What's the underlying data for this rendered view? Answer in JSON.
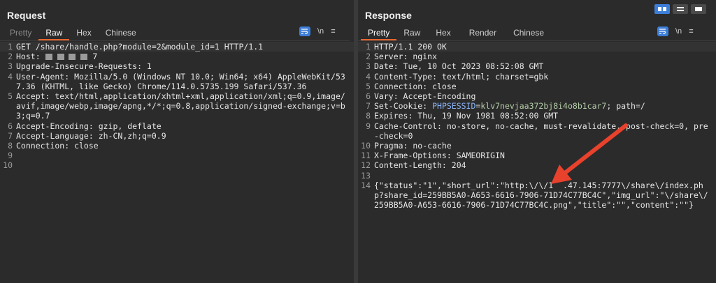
{
  "request": {
    "title": "Request",
    "tabs": [
      "Pretty",
      "Raw",
      "Hex",
      "Chinese"
    ],
    "active_tab": "Raw",
    "newline_label": "\\n",
    "lines": [
      {
        "n": "1",
        "text": "GET /share/handle.php?module=2&module_id=1 HTTP/1.1"
      },
      {
        "n": "2",
        "host_label": "Host:",
        "host_suffix": "7"
      },
      {
        "n": "3",
        "text": "Upgrade-Insecure-Requests: 1"
      },
      {
        "n": "4",
        "text": "User-Agent: Mozilla/5.0 (Windows NT 10.0; Win64; x64) AppleWebKit/537.36 (KHTML, like Gecko) Chrome/114.0.5735.199 Safari/537.36"
      },
      {
        "n": "5",
        "text": "Accept: text/html,application/xhtml+xml,application/xml;q=0.9,image/avif,image/webp,image/apng,*/*;q=0.8,application/signed-exchange;v=b3;q=0.7"
      },
      {
        "n": "6",
        "text": "Accept-Encoding: gzip, deflate"
      },
      {
        "n": "7",
        "text": "Accept-Language: zh-CN,zh;q=0.9"
      },
      {
        "n": "8",
        "text": "Connection: close"
      },
      {
        "n": "9",
        "text": ""
      },
      {
        "n": "10",
        "text": ""
      }
    ]
  },
  "response": {
    "title": "Response",
    "tabs": [
      "Pretty",
      "Raw",
      "Hex",
      "Render",
      "Chinese"
    ],
    "active_tab": "Pretty",
    "newline_label": "\\n",
    "lines": [
      {
        "n": "1",
        "text": "HTTP/1.1 200 OK"
      },
      {
        "n": "2",
        "text": "Server: nginx"
      },
      {
        "n": "3",
        "text": "Date: Tue, 10 Oct 2023 08:52:08 GMT"
      },
      {
        "n": "4",
        "text": "Content-Type: text/html; charset=gbk"
      },
      {
        "n": "5",
        "text": "Connection: close"
      },
      {
        "n": "6",
        "text": "Vary: Accept-Encoding"
      },
      {
        "n": "7",
        "cookie_label": "Set-Cookie: ",
        "cookie_name": "PHPSESSID",
        "cookie_eq": "=",
        "cookie_value": "klv7nevjaa372bj8i4o8b1car7",
        "cookie_rest": "; path=/"
      },
      {
        "n": "8",
        "text": "Expires: Thu, 19 Nov 1981 08:52:00 GMT"
      },
      {
        "n": "9",
        "text": "Cache-Control: no-store, no-cache, must-revalidate, post-check=0, pre-check=0"
      },
      {
        "n": "10",
        "text": "Pragma: no-cache"
      },
      {
        "n": "11",
        "text": "X-Frame-Options: SAMEORIGIN"
      },
      {
        "n": "12",
        "text": "Content-Length: 204"
      },
      {
        "n": "13",
        "text": ""
      },
      {
        "n": "14",
        "text": "{\"status\":\"1\",\"short_url\":\"http:\\/\\/1  .47.145:7777\\/share\\/index.php?share_id=259BB5A0-A653-6616-7906-71D74C77BC4C\",\"img_url\":\"\\/share\\/259BB5A0-A653-6616-7906-71D74C77BC4C.png\",\"title\":\"\",\"content\":\"\"}"
      }
    ]
  },
  "colors": {
    "accent": "#e8672f",
    "arrow": "#e8412c",
    "button_blue": "#3d7ed8"
  }
}
